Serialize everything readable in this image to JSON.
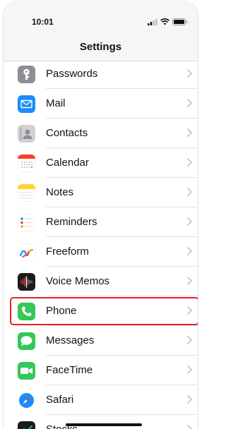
{
  "status_bar": {
    "time": "10:01"
  },
  "nav": {
    "title": "Settings"
  },
  "settings_rows": [
    {
      "label": "Passwords",
      "icon": "key-icon",
      "color": "#8e8e93"
    },
    {
      "label": "Mail",
      "icon": "mail-icon",
      "color": "#1a8cff"
    },
    {
      "label": "Contacts",
      "icon": "contacts-icon",
      "color": "#c9c9ce"
    },
    {
      "label": "Calendar",
      "icon": "calendar-icon",
      "color": "#ffffff"
    },
    {
      "label": "Notes",
      "icon": "notes-icon",
      "color": "#ffffff"
    },
    {
      "label": "Reminders",
      "icon": "reminders-icon",
      "color": "#ffffff"
    },
    {
      "label": "Freeform",
      "icon": "freeform-icon",
      "color": "#ffffff"
    },
    {
      "label": "Voice Memos",
      "icon": "voice-memos-icon",
      "color": "#1c1c1e"
    },
    {
      "label": "Phone",
      "icon": "phone-icon",
      "color": "#34c759"
    },
    {
      "label": "Messages",
      "icon": "messages-icon",
      "color": "#34c759"
    },
    {
      "label": "FaceTime",
      "icon": "facetime-icon",
      "color": "#34c759"
    },
    {
      "label": "Safari",
      "icon": "safari-icon",
      "color": "#1a8cff"
    },
    {
      "label": "Stocks",
      "icon": "stocks-icon",
      "color": "#1c1c1e"
    }
  ],
  "highlighted_row": "Phone",
  "highlight_color": "#e0242a"
}
